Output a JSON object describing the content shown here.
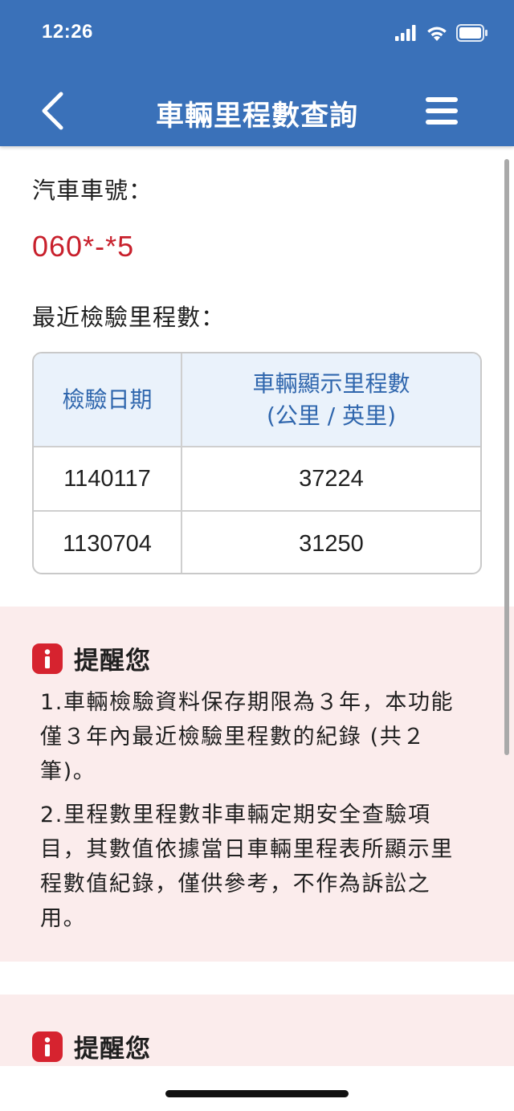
{
  "status_bar": {
    "time": "12:26",
    "icons": [
      "signal-icon",
      "wifi-icon",
      "battery-icon"
    ]
  },
  "nav": {
    "title": "車輛里程數查詢",
    "back_icon": "chevron-left-icon",
    "menu_icon": "hamburger-menu-icon"
  },
  "vehicle": {
    "plate_label": "汽車車號：",
    "plate_value": "060*-*5"
  },
  "mileage": {
    "section_label": "最近檢驗里程數：",
    "headers": {
      "date": "檢驗日期",
      "reading_line1": "車輛顯示里程數",
      "reading_line2": "(公里 / 英里)"
    },
    "rows": [
      {
        "date": "1140117",
        "reading": "37224"
      },
      {
        "date": "1130704",
        "reading": "31250"
      }
    ]
  },
  "reminders": [
    {
      "title": "提醒您",
      "items": [
        "1.車輛檢驗資料保存期限為３年，本功能僅３年內最近檢驗里程數的紀錄 (共２筆)。",
        "2.里程數里程數非車輛定期安全查驗項目，其數值依據當日車輛里程表所顯示里程數值紀錄，僅供參考，不作為訴訟之用。"
      ]
    },
    {
      "title": "提醒您"
    }
  ],
  "colors": {
    "header_bg": "#3a71b9",
    "plate_red": "#c8202c",
    "table_header_bg": "#eaf2fb",
    "table_header_text": "#2f66ad",
    "notice_bg": "#fbecec",
    "info_badge": "#d6232f"
  }
}
